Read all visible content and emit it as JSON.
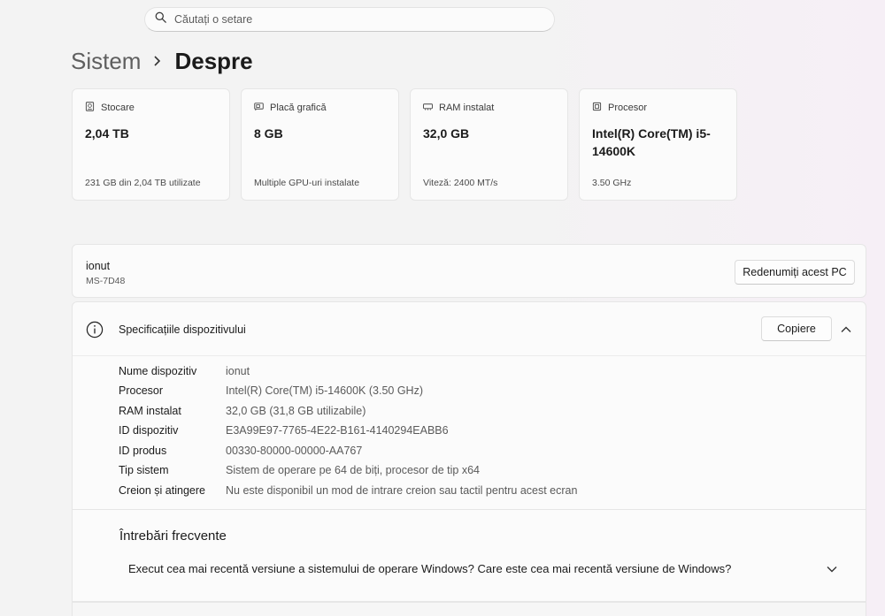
{
  "search": {
    "placeholder": "Căutați o setare",
    "icon": "search-icon"
  },
  "breadcrumb": {
    "parent": "Sistem",
    "current": "Despre"
  },
  "cards": [
    {
      "icon": "storage-icon",
      "label": "Stocare",
      "value": "2,04 TB",
      "sub": "231 GB din 2,04 TB utilizate"
    },
    {
      "icon": "gpu-icon",
      "label": "Placă grafică",
      "value": "8 GB",
      "sub": "Multiple GPU-uri instalate"
    },
    {
      "icon": "ram-icon",
      "label": "RAM instalat",
      "value": "32,0 GB",
      "sub": "Viteză: 2400 MT/s"
    },
    {
      "icon": "processor-icon",
      "label": "Procesor",
      "value": "Intel(R) Core(TM) i5-14600K",
      "sub": "3.50 GHz"
    }
  ],
  "pc": {
    "name": "ionut",
    "model": "MS-7D48",
    "rename_label": "Redenumiți acest PC"
  },
  "specs": {
    "title": "Specificațiile dispozitivului",
    "copy_label": "Copiere",
    "rows": [
      {
        "label": "Nume dispozitiv",
        "value": "ionut"
      },
      {
        "label": "Procesor",
        "value": "Intel(R) Core(TM) i5-14600K (3.50 GHz)"
      },
      {
        "label": "RAM instalat",
        "value": "32,0 GB (31,8 GB utilizabile)"
      },
      {
        "label": "ID dispozitiv",
        "value": "E3A99E97-7765-4E22-B161-4140294EABB6"
      },
      {
        "label": "ID produs",
        "value": "00330-80000-00000-AA767"
      },
      {
        "label": "Tip sistem",
        "value": "Sistem de operare pe 64 de biți, procesor de tip x64"
      },
      {
        "label": "Creion și atingere",
        "value": "Nu este disponibil un mod de intrare creion sau tactil pentru acest ecran"
      }
    ]
  },
  "faq": {
    "title": "Întrebări frecvente",
    "question": "Execut cea mai recentă versiune a sistemului de operare Windows? Care este cea mai recentă versiune de Windows?"
  }
}
